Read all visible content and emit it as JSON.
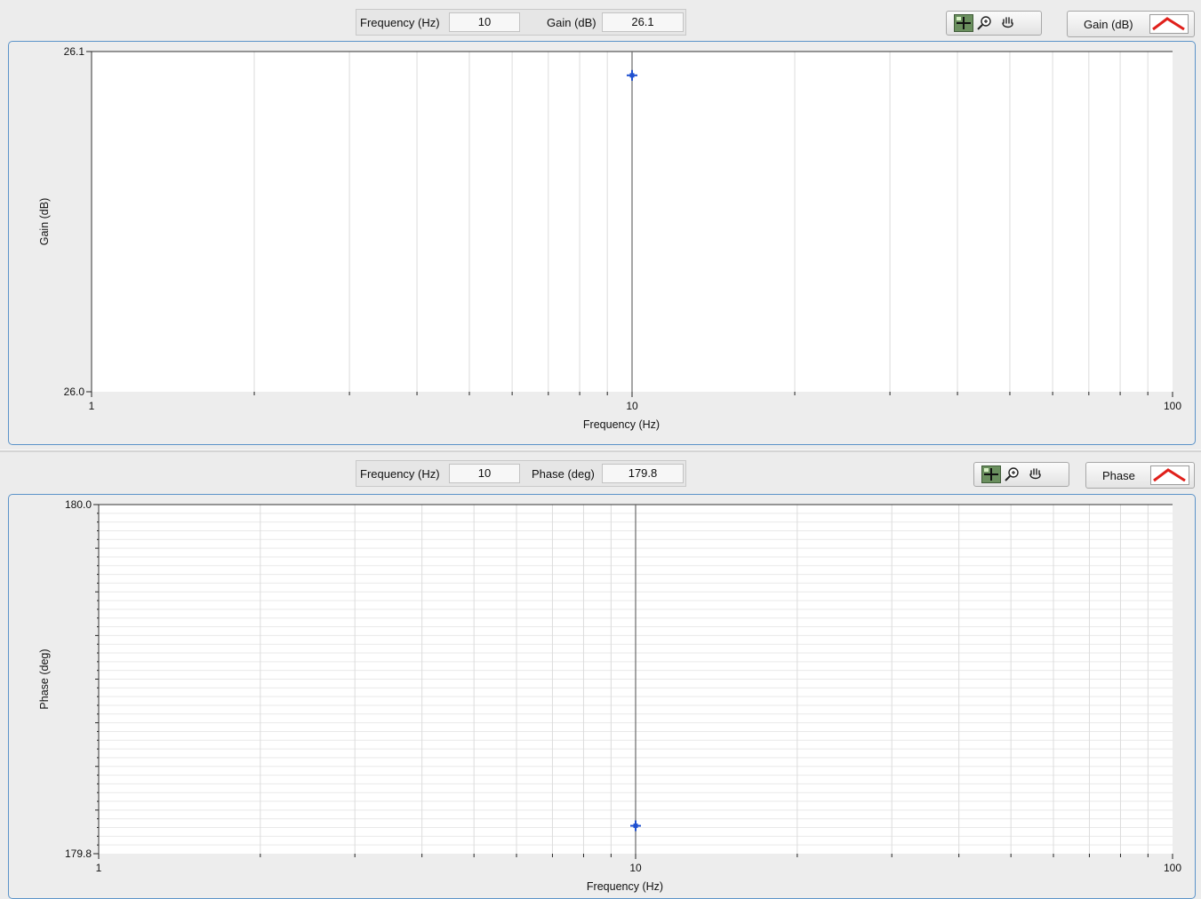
{
  "gain_panel": {
    "readout": {
      "x_label": "Frequency (Hz)",
      "x_value": "10",
      "y_label": "Gain (dB)",
      "y_value": "26.1"
    },
    "toolbar": {
      "tools": [
        "cursor-move-icon",
        "zoom-icon",
        "pan-hand-icon"
      ]
    },
    "legend": {
      "label": "Gain (dB)",
      "swatch_color": "#e0201b",
      "swatch_icon": "line-plot-icon"
    }
  },
  "phase_panel": {
    "readout": {
      "x_label": "Frequency (Hz)",
      "x_value": "10",
      "y_label": "Phase (deg)",
      "y_value": "179.8"
    },
    "toolbar": {
      "tools": [
        "cursor-move-icon",
        "zoom-icon",
        "pan-hand-icon"
      ]
    },
    "legend": {
      "label": "Phase",
      "swatch_color": "#e0201b",
      "swatch_icon": "line-plot-icon"
    }
  },
  "colors": {
    "frame_border": "#5b93c9",
    "marker": "#1f50d0",
    "cursor_line": "#6a6a6a",
    "grid": "#dcdcdc"
  },
  "chart_data": [
    {
      "type": "scatter",
      "x_scale": "log",
      "xlabel": "Frequency (Hz)",
      "ylabel": "Gain (dB)",
      "xlim": [
        1,
        100
      ],
      "ylim": [
        26.0,
        26.1
      ],
      "x_ticks": [
        "1",
        "10",
        "100"
      ],
      "y_ticks": [
        "26.0",
        "26.1"
      ],
      "grid": "vertical",
      "points": [
        {
          "x": 10,
          "y": 26.093
        }
      ],
      "cursor_x": 10
    },
    {
      "type": "scatter",
      "x_scale": "log",
      "xlabel": "Frequency (Hz)",
      "ylabel": "Phase (deg)",
      "xlim": [
        1,
        100
      ],
      "ylim": [
        179.8,
        180.0
      ],
      "x_ticks": [
        "1",
        "10",
        "100"
      ],
      "y_ticks": [
        "179.8",
        "180.0"
      ],
      "grid": "both",
      "points": [
        {
          "x": 10,
          "y": 179.816
        }
      ],
      "cursor_x": 10
    }
  ]
}
